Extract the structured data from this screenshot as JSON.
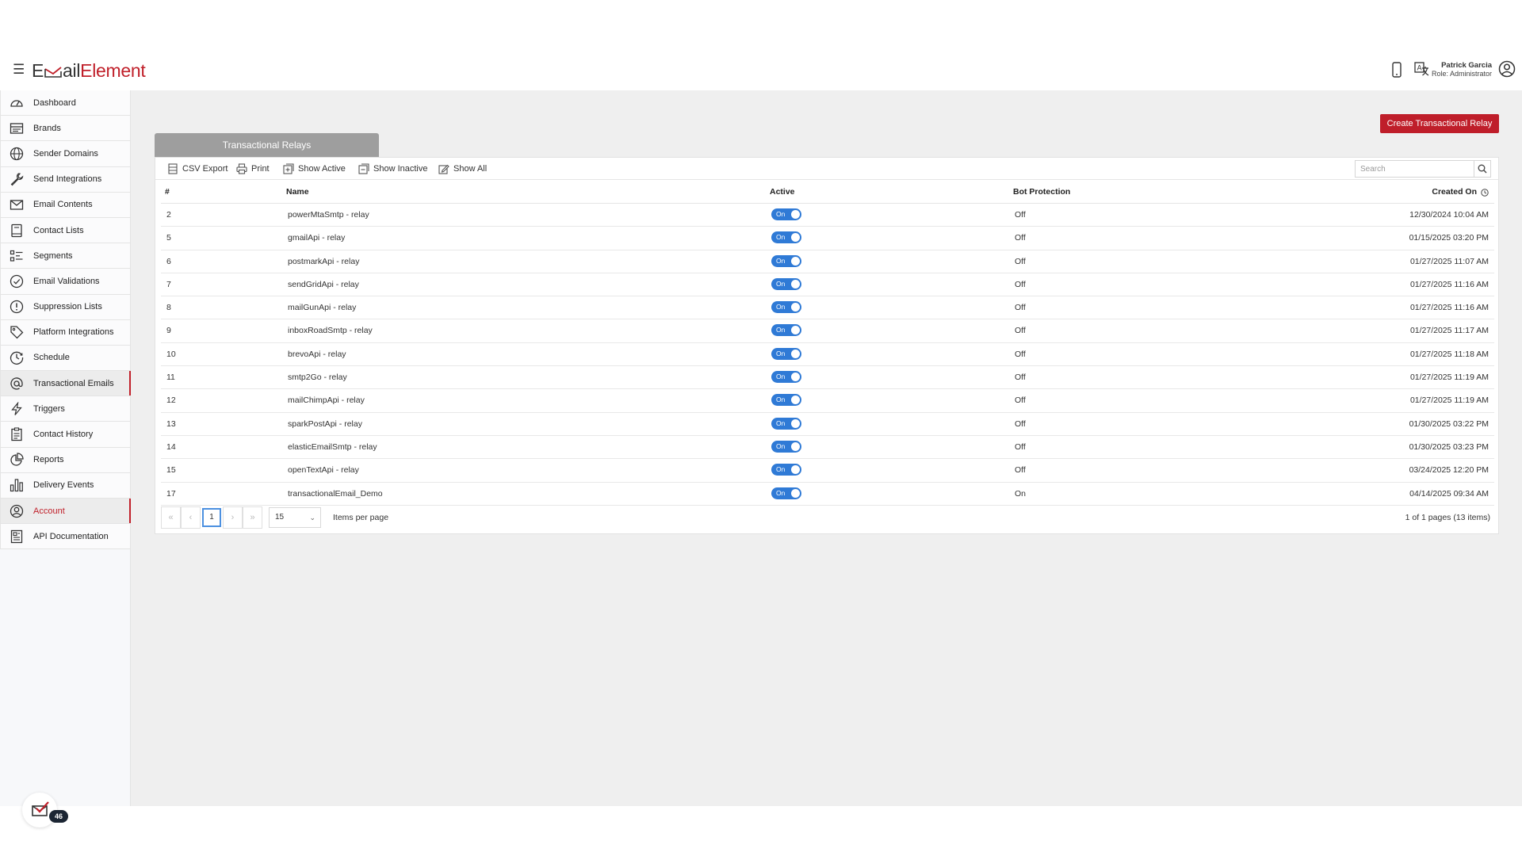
{
  "header": {
    "logo_prefix": "E",
    "logo_mid": "ail",
    "logo_suffix": "Element",
    "user_name": "Patrick Garcia",
    "user_role": "Role: Administrator",
    "icons": [
      "hamburger-icon",
      "mobile-icon",
      "translate-icon",
      "user-circle-icon"
    ]
  },
  "sidebar": {
    "items": [
      {
        "label": "Dashboard",
        "icon": "dashboard-gauge-icon"
      },
      {
        "label": "Brands",
        "icon": "brands-icon"
      },
      {
        "label": "Sender Domains",
        "icon": "globe-icon"
      },
      {
        "label": "Send Integrations",
        "icon": "wrench-icon"
      },
      {
        "label": "Email Contents",
        "icon": "envelope-icon"
      },
      {
        "label": "Contact Lists",
        "icon": "book-icon"
      },
      {
        "label": "Segments",
        "icon": "segments-list-icon"
      },
      {
        "label": "Email Validations",
        "icon": "check-circle-icon"
      },
      {
        "label": "Suppression Lists",
        "icon": "exclamation-circle-icon"
      },
      {
        "label": "Platform Integrations",
        "icon": "tag-icon"
      },
      {
        "label": "Schedule",
        "icon": "clock-icon"
      },
      {
        "label": "Transactional Emails",
        "icon": "at-sign-icon"
      },
      {
        "label": "Triggers",
        "icon": "lightning-icon"
      },
      {
        "label": "Contact History",
        "icon": "clipboard-icon"
      },
      {
        "label": "Reports",
        "icon": "pie-chart-icon"
      },
      {
        "label": "Delivery Events",
        "icon": "bar-chart-icon"
      },
      {
        "label": "Account",
        "icon": "account-circle-icon"
      },
      {
        "label": "API Documentation",
        "icon": "document-icon"
      }
    ],
    "badge_count": "46"
  },
  "content": {
    "create_button": "Create Transactional Relay",
    "tab_label": "Transactional Relays",
    "toolbar": {
      "csv_export": "CSV Export",
      "print": "Print",
      "show_active": "Show Active",
      "show_inactive": "Show Inactive",
      "show_all": "Show All",
      "search_placeholder": "Search"
    },
    "columns": {
      "num": "#",
      "name": "Name",
      "active": "Active",
      "bot": "Bot Protection",
      "created": "Created On"
    },
    "toggle_on_label": "On",
    "rows": [
      {
        "num": "2",
        "name": "powerMtaSmtp - relay",
        "active": true,
        "bot": "Off",
        "created": "12/30/2024 10:04 AM"
      },
      {
        "num": "5",
        "name": "gmailApi - relay",
        "active": true,
        "bot": "Off",
        "created": "01/15/2025 03:20 PM"
      },
      {
        "num": "6",
        "name": "postmarkApi - relay",
        "active": true,
        "bot": "Off",
        "created": "01/27/2025 11:07 AM"
      },
      {
        "num": "7",
        "name": "sendGridApi - relay",
        "active": true,
        "bot": "Off",
        "created": "01/27/2025 11:16 AM"
      },
      {
        "num": "8",
        "name": "mailGunApi - relay",
        "active": true,
        "bot": "Off",
        "created": "01/27/2025 11:16 AM"
      },
      {
        "num": "9",
        "name": "inboxRoadSmtp - relay",
        "active": true,
        "bot": "Off",
        "created": "01/27/2025 11:17 AM"
      },
      {
        "num": "10",
        "name": "brevoApi - relay",
        "active": true,
        "bot": "Off",
        "created": "01/27/2025 11:18 AM"
      },
      {
        "num": "11",
        "name": "smtp2Go - relay",
        "active": true,
        "bot": "Off",
        "created": "01/27/2025 11:19 AM"
      },
      {
        "num": "12",
        "name": "mailChimpApi - relay",
        "active": true,
        "bot": "Off",
        "created": "01/27/2025 11:19 AM"
      },
      {
        "num": "13",
        "name": "sparkPostApi - relay",
        "active": true,
        "bot": "Off",
        "created": "01/30/2025 03:22 PM"
      },
      {
        "num": "14",
        "name": "elasticEmailSmtp - relay",
        "active": true,
        "bot": "Off",
        "created": "01/30/2025 03:23 PM"
      },
      {
        "num": "15",
        "name": "openTextApi - relay",
        "active": true,
        "bot": "Off",
        "created": "03/24/2025 12:20 PM"
      },
      {
        "num": "17",
        "name": "transactionalEmail_Demo",
        "active": true,
        "bot": "On",
        "created": "04/14/2025 09:34 AM"
      }
    ],
    "pager": {
      "first": "«",
      "prev": "‹",
      "current": "1",
      "next": "›",
      "last": "»",
      "page_size": "15",
      "items_per_page": "Items per page",
      "info": "1 of 1 pages (13 items)"
    }
  },
  "colors": {
    "brand_red": "#c0202a",
    "toggle_blue": "#2f7ad6",
    "tab_gray": "#9e9e9e"
  }
}
